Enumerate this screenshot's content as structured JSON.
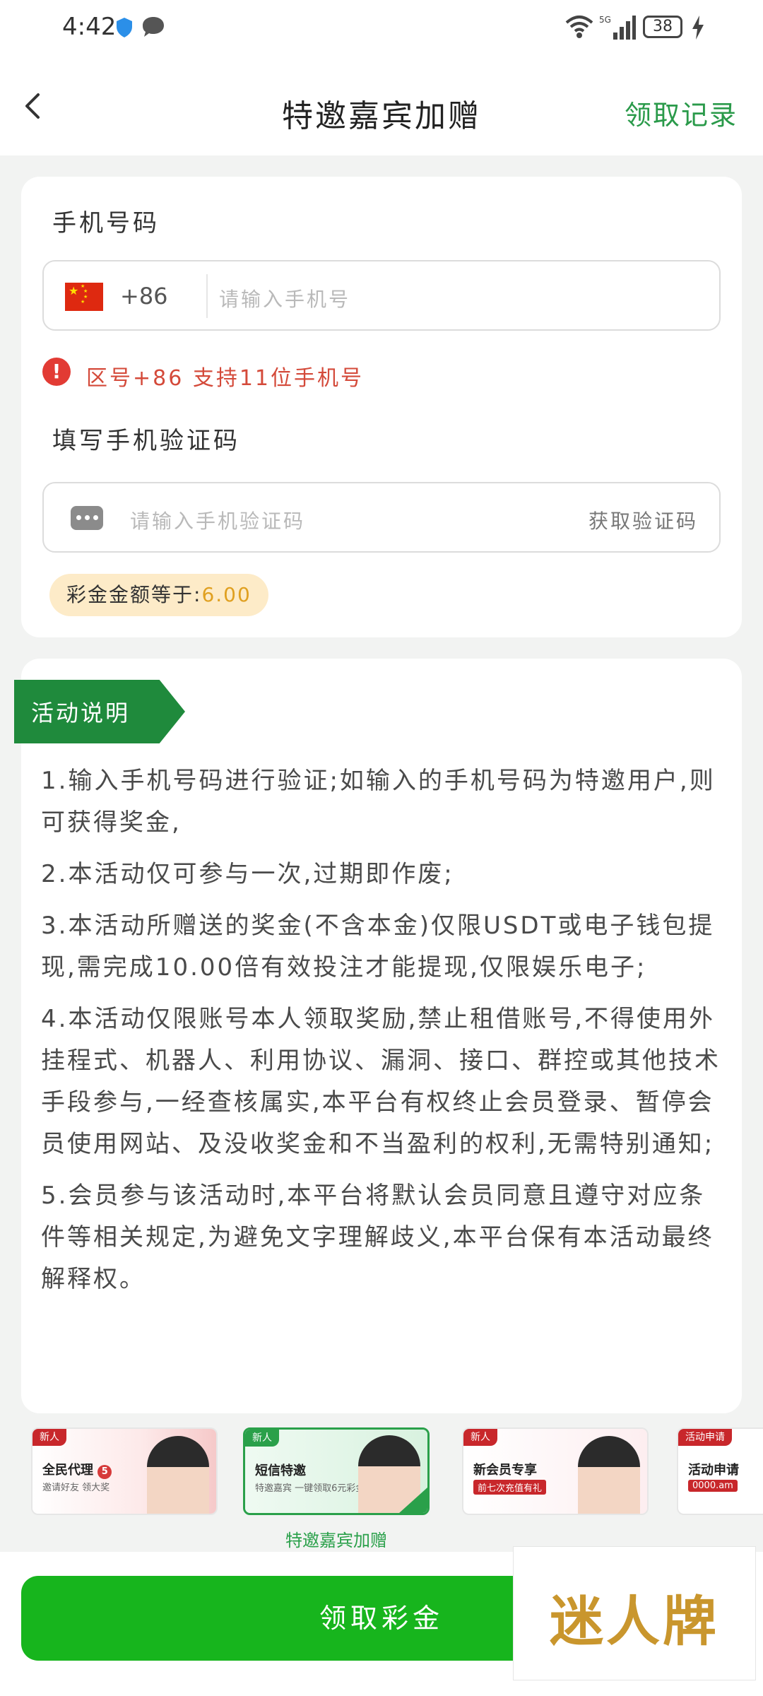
{
  "status_bar": {
    "time": "4:42",
    "battery": "38"
  },
  "header": {
    "title": "特邀嘉宾加赠",
    "records_link": "领取记录"
  },
  "form": {
    "phone_label": "手机号码",
    "country_code": "+86",
    "phone_placeholder": "请输入手机号",
    "warning": "区号+86 支持11位手机号",
    "sms_label": "填写手机验证码",
    "sms_placeholder": "请输入手机验证码",
    "get_code": "获取验证码",
    "amount_label": "彩金金额等于:",
    "amount_value": "6.00"
  },
  "rules": {
    "title": "活动说明",
    "items": [
      "1.输入手机号码进行验证;如输入的手机号码为特邀用户,则可获得奖金,",
      "2.本活动仅可参与一次,过期即作废;",
      "3.本活动所赠送的奖金(不含本金)仅限USDT或电子钱包提现,需完成10.00倍有效投注才能提现,仅限娱乐电子;",
      "4.本活动仅限账号本人领取奖励,禁止租借账号,不得使用外挂程式、机器人、利用协议、漏洞、接口、群控或其他技术手段参与,一经查核属实,本平台有权终止会员登录、暂停会员使用网站、及没收奖金和不当盈利的权利,无需特别通知;",
      "5.会员参与该活动时,本平台将默认会员同意且遵守对应条件等相关规定,为避免文字理解歧义,本平台保有本活动最终解释权。"
    ]
  },
  "banners": [
    {
      "tag": "新人",
      "title": "全民代理",
      "badge": "5",
      "subtitle": "邀请好友 领大奖",
      "selected": false
    },
    {
      "tag": "新人",
      "title": "短信特邀",
      "subtitle": "特邀嘉宾 一键领取6元彩金",
      "caption": "特邀嘉宾加赠",
      "selected": true
    },
    {
      "tag": "新人",
      "title": "新会员专享",
      "subtitle": "前七次充值有礼",
      "selected": false
    },
    {
      "tag": "活动申请",
      "title": "活动申请",
      "subtitle": "0000.am",
      "selected": false
    }
  ],
  "cta": {
    "label": "领取彩金"
  },
  "watermark": {
    "text": "迷人牌"
  },
  "colors": {
    "accent_green": "#17b51d",
    "link_green": "#2a9a4a",
    "ribbon_green": "#1f8a3c",
    "warning_red": "#d44a3a",
    "amount_gold": "#e0a020"
  }
}
